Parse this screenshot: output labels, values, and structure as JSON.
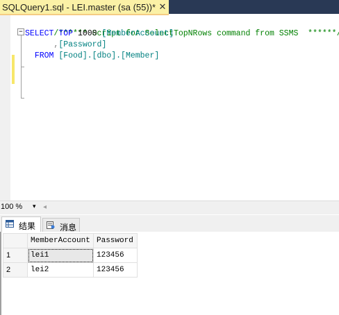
{
  "tab": {
    "title": "SQLQuery1.sql - LEI.master (sa (55))*",
    "close_glyph": "✕"
  },
  "editor": {
    "lines": {
      "l1": {
        "comment": "/****** Script for SelectTopNRows command from SSMS  ******/"
      },
      "l2": {
        "kw1": "SELECT",
        "kw2": "TOP",
        "num": "1000",
        "col": "[MemberAccount]"
      },
      "l3": {
        "comma": ",",
        "col": "[Password]"
      },
      "l4": {
        "kw": "FROM",
        "obj": "[Food].[dbo].[Member]"
      }
    },
    "collapse_glyph": "−"
  },
  "zoom": {
    "value": "100 %",
    "arrow": "▾",
    "scroll_arrow": "◂"
  },
  "results_tabs": {
    "results_label": "结果",
    "messages_label": "消息"
  },
  "grid": {
    "columns": [
      "MemberAccount",
      "Password"
    ],
    "rows": [
      {
        "num": "1",
        "MemberAccount": "lei1",
        "Password": "123456"
      },
      {
        "num": "2",
        "MemberAccount": "lei2",
        "Password": "123456"
      }
    ]
  },
  "colors": {
    "tab_active_bg": "#fbf1a6",
    "titlebar_bg": "#293955",
    "comment": "#008000",
    "keyword": "#0000ff",
    "identifier": "#008080"
  }
}
